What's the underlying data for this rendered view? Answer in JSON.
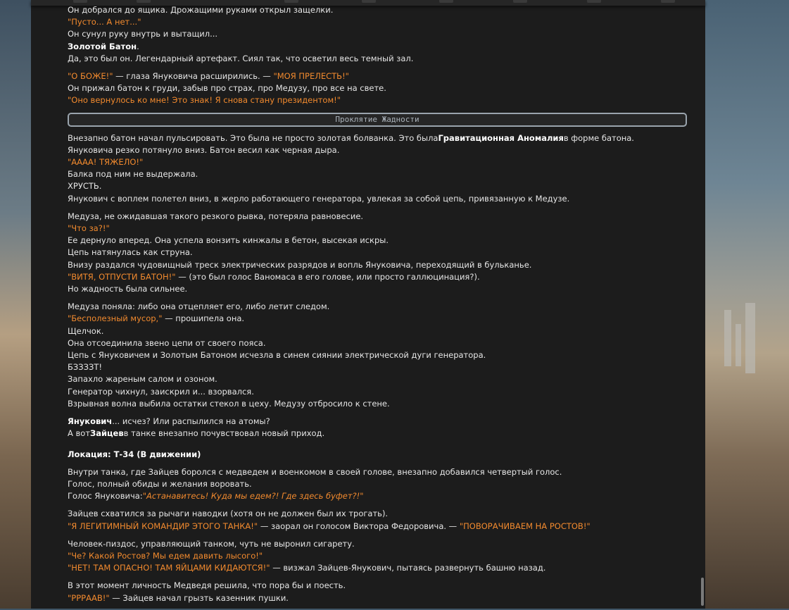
{
  "story": {
    "p1": {
      "l1": "Он добрался до ящика. Дрожащими руками открыл защелки.",
      "l2": "\"Пусто... А нет...\"",
      "l3": "Он сунул руку внутрь и вытащил...",
      "l4_b": "Золотой Батон",
      "l4_t": ".",
      "l5": "Да, это был он. Легендарный артефакт. Сиял так, что осветил весь темный зал."
    },
    "p2": {
      "l1_q1": "\"О БОЖЕ!\"",
      "l1_t": " — глаза Януковича расширились. — ",
      "l1_q2": "\"МОЯ ПРЕЛЕСТЬ!\"",
      "l2": "Он прижал батон к груди, забыв про страх, про Медузу, про все на свете.",
      "l3": "\"Оно вернулось ко мне! Это знак! Я снова стану президентом!\""
    },
    "divider": "Проклятие Жадности",
    "p3": {
      "l1_a": "Внезапно батон начал пульсировать. Это была не просто золотая болванка. Это была",
      "l1_b": "Гравитационная Аномалия",
      "l1_c": "в форме батона.",
      "l2": "Януковича резко потянуло вниз. Батон весил как черная дыра.",
      "l3": "\"АААА! ТЯЖЕЛО!\"",
      "l4": "Балка под ним не выдержала.",
      "l5": "ХРУСТЬ.",
      "l6": "Янукович с воплем полетел вниз, в жерло работающего генератора, увлекая за собой цепь, привязанную к Медузе."
    },
    "p4": {
      "l1": "Медуза, не ожидавшая такого резкого рывка, потеряла равновесие.",
      "l2": "\"Что за?!\"",
      "l3": "Ее дернуло вперед. Она успела вонзить кинжалы в бетон, высекая искры.",
      "l4": "Цепь натянулась как струна.",
      "l5": "Внизу раздался чудовищный треск электрических разрядов и вопль Януковича, переходящий в бульканье.",
      "l6_q": "\"ВИТЯ, ОТПУСТИ БАТОН!\"",
      "l6_t": " — (это был голос Ваномаса в его голове, или просто галлюцинация?).",
      "l7": "Но жадность была сильнее."
    },
    "p5": {
      "l1": "Медуза поняла: либо она отцепляет его, либо летит следом.",
      "l2_q": "\"Бесполезный мусор,\"",
      "l2_t": " — прошипела она.",
      "l3": "Щелчок.",
      "l4": "Она отсоединила звено цепи от своего пояса.",
      "l5": "Цепь с Януковичем и Золотым Батоном исчезла в синем сиянии электрической дуги генератора.",
      "l6": "БЗЗЗЗТ!",
      "l7": "Запахло жареным салом и озоном.",
      "l8": "Генератор чихнул, заискрил и... взорвался.",
      "l9": "Взрывная волна выбила остатки стекол в цеху. Медузу отбросило к стене."
    },
    "p6": {
      "l1_b": "Янукович",
      "l1_t": "... исчез? Или распылился на атомы?",
      "l2_a": "А вот",
      "l2_b": "Зайцев",
      "l2_c": "в танке внезапно почувствовал новый приход."
    },
    "location": "Локация: Т-34 (В движении)",
    "p7": {
      "l1": "Внутри танка, где Зайцев боролся с медведем и военкомом в своей голове, внезапно добавился четвертый голос.",
      "l2": "Голос, полный обиды и желания воровать.",
      "l3_t": "Голос Януковича:",
      "l3_q": "\"Астанавитесь! Куда мы едем?! Где здесь буфет?!\""
    },
    "p8": {
      "l1": "Зайцев схватился за рычаги наводки (хотя он не должен был их трогать).",
      "l2_q1": "\"Я ЛЕГИТИМНЫЙ КОМАНДИР ЭТОГО ТАНКА!\"",
      "l2_t": " — заорал он голосом Виктора Федоровича. — ",
      "l2_q2": "\"ПОВОРАЧИВАЕМ НА РОСТОВ!\""
    },
    "p9": {
      "l1": "Человек-пиздос, управляющий танком, чуть не выронил сигарету.",
      "l2": "\"Че? Какой Ростов? Мы едем давить лысого!\"",
      "l3_q": "\"НЕТ! ТАМ ОПАСНО! ТАМ ЯЙЦАМИ КИДАЮТСЯ!\"",
      "l3_t": " — визжал Зайцев-Янукович, пытаясь развернуть башню назад."
    },
    "p10": {
      "l1": "В этот момент личность Медведя решила, что пора бы и поесть.",
      "l2_q": "\"РРРААВ!\"",
      "l2_t": " — Зайцев начал грызть казенник пушки."
    }
  },
  "colors": {
    "quote": "#f28a2e",
    "text": "#e6e6e6",
    "panel": "#1c1c1c",
    "divider_border": "#9aa4ad"
  }
}
